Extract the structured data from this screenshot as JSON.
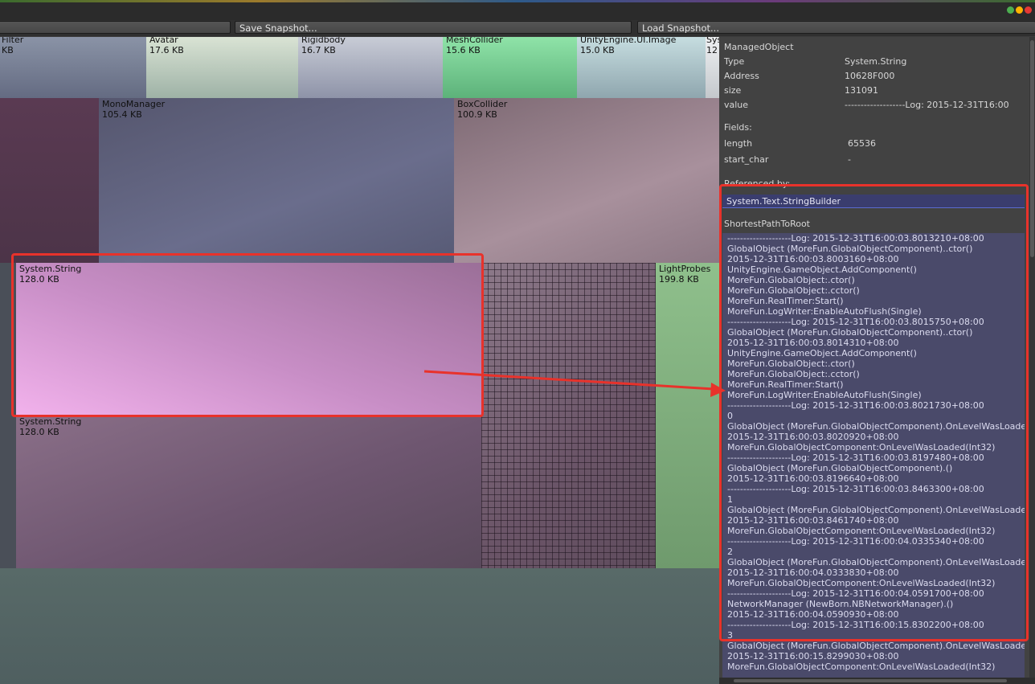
{
  "toolbar": {
    "save_label": "Save Snapshot...",
    "load_label": "Load Snapshot..."
  },
  "window": {
    "dot_colors": [
      "#4caf50",
      "#ffb300",
      "#e53935"
    ]
  },
  "treemap": {
    "cells": [
      {
        "name": "Filter",
        "size": "KB"
      },
      {
        "name": "Avatar",
        "size": "17.6 KB"
      },
      {
        "name": "Rigidbody",
        "size": "16.7 KB"
      },
      {
        "name": "MeshCollider",
        "size": "15.6 KB"
      },
      {
        "name": "UnityEngine.UI.Image",
        "size": "15.0 KB"
      },
      {
        "name": "Sys",
        "size": "12"
      },
      {
        "name": "MonoManager",
        "size": "105.4 KB"
      },
      {
        "name": "BoxCollider",
        "size": "100.9 KB"
      },
      {
        "name": "System.String",
        "size": "128.0 KB"
      },
      {
        "name": "LightProbes",
        "size": "199.8 KB"
      },
      {
        "name": "System.String",
        "size": "128.0 KB"
      }
    ]
  },
  "inspector": {
    "header": "ManagedObject",
    "props": [
      {
        "key": "Type",
        "value": "System.String"
      },
      {
        "key": "Address",
        "value": "10628F000"
      },
      {
        "key": "size",
        "value": "131091"
      },
      {
        "key": "value",
        "value": "-------------------Log: 2015-12-31T16:00"
      }
    ],
    "fields_label": "Fields:",
    "fields": [
      {
        "key": "length",
        "value": "65536"
      },
      {
        "key": "start_char",
        "value": "-"
      }
    ],
    "referenced_by_label": "Referenced by:",
    "referenced_by": [
      "System.Text.StringBuilder"
    ],
    "shortest_path_label": "ShortestPathToRoot",
    "path_lines": [
      "--------------------Log: 2015-12-31T16:00:03.8013210+08:00",
      "GlobalObject (MoreFun.GlobalObjectComponent)..ctor()",
      "2015-12-31T16:00:03.8003160+08:00",
      "UnityEngine.GameObject.AddComponent()",
      "MoreFun.GlobalObject:.ctor()",
      "MoreFun.GlobalObject:.cctor()",
      "MoreFun.RealTimer:Start()",
      "MoreFun.LogWriter:EnableAutoFlush(Single)",
      "--------------------Log: 2015-12-31T16:00:03.8015750+08:00",
      "GlobalObject (MoreFun.GlobalObjectComponent)..ctor()",
      "2015-12-31T16:00:03.8014310+08:00",
      "UnityEngine.GameObject.AddComponent()",
      "MoreFun.GlobalObject:.ctor()",
      "MoreFun.GlobalObject:.cctor()",
      "MoreFun.RealTimer:Start()",
      "MoreFun.LogWriter:EnableAutoFlush(Single)",
      "--------------------Log: 2015-12-31T16:00:03.8021730+08:00",
      "0",
      "GlobalObject (MoreFun.GlobalObjectComponent).OnLevelWasLoaded(",
      "2015-12-31T16:00:03.8020920+08:00",
      "MoreFun.GlobalObjectComponent:OnLevelWasLoaded(Int32)",
      "--------------------Log: 2015-12-31T16:00:03.8197480+08:00",
      "GlobalObject (MoreFun.GlobalObjectComponent).()",
      "2015-12-31T16:00:03.8196640+08:00",
      "--------------------Log: 2015-12-31T16:00:03.8463300+08:00",
      "1",
      "GlobalObject (MoreFun.GlobalObjectComponent).OnLevelWasLoaded(",
      "2015-12-31T16:00:03.8461740+08:00",
      "MoreFun.GlobalObjectComponent:OnLevelWasLoaded(Int32)",
      "--------------------Log: 2015-12-31T16:00:04.0335340+08:00",
      "2",
      "GlobalObject (MoreFun.GlobalObjectComponent).OnLevelWasLoaded(",
      "2015-12-31T16:00:04.0333830+08:00",
      "MoreFun.GlobalObjectComponent:OnLevelWasLoaded(Int32)",
      "--------------------Log: 2015-12-31T16:00:04.0591700+08:00",
      "NetworkManager (NewBorn.NBNetworkManager).()",
      "2015-12-31T16:00:04.0590930+08:00",
      "--------------------Log: 2015-12-31T16:00:15.8302200+08:00",
      "3",
      "GlobalObject (MoreFun.GlobalObjectComponent).OnLevelWasLoaded(",
      "2015-12-31T16:00:15.8299030+08:00",
      "MoreFun.GlobalObjectComponent:OnLevelWasLoaded(Int32)"
    ]
  }
}
